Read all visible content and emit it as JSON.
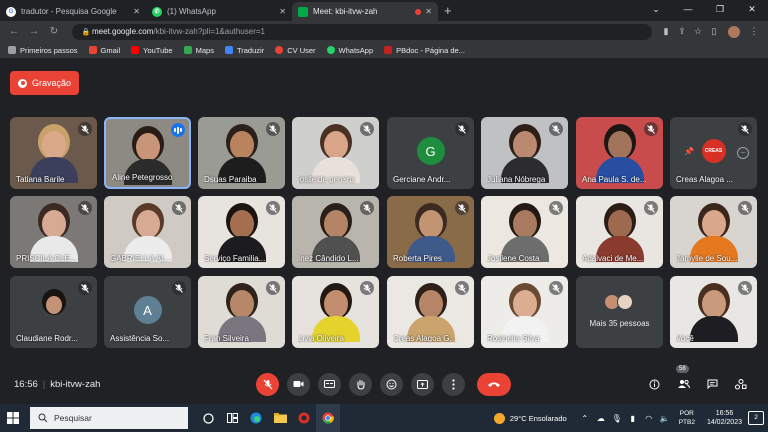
{
  "browser": {
    "tabs": [
      {
        "title": "tradutor - Pesquisa Google",
        "icon": "google-icon",
        "color": "#ffffff"
      },
      {
        "title": "(1) WhatsApp",
        "icon": "whatsapp-icon",
        "color": "#25d366"
      },
      {
        "title": "Meet: kbi-itvw-zah",
        "icon": "meet-icon",
        "color": "#00ac47",
        "active": true
      }
    ],
    "new_tab": "+",
    "url_host": "meet.google.com",
    "url_path": "/kbi-itvw-zah?pli=1&authuser=1",
    "bookmarks": [
      {
        "label": "Primeiros passos",
        "color": "#9aa0a6"
      },
      {
        "label": "Gmail",
        "color": "#ea4335"
      },
      {
        "label": "YouTube",
        "color": "#ff0000"
      },
      {
        "label": "Maps",
        "color": "#34a853"
      },
      {
        "label": "Traduzir",
        "color": "#4285f4"
      },
      {
        "label": "CV User",
        "color": "#ea4335"
      },
      {
        "label": "WhatsApp",
        "color": "#25d366"
      },
      {
        "label": "PBdoc - Página de...",
        "color": "#c5221f"
      }
    ]
  },
  "meet": {
    "recording_label": "Gravação",
    "participants": [
      {
        "name": "Tatiana Barile",
        "skin": "#d9a98a",
        "hair": "#c9a26a",
        "bg": "#6b5a4b",
        "shirt": "#3b3f5c"
      },
      {
        "name": "Aline Petegrosso",
        "skin": "#c89578",
        "hair": "#2a1d17",
        "bg": "#8d8a84",
        "shirt": "#2b2b2b",
        "speaking": true
      },
      {
        "name": "Dsuas Paraiba",
        "skin": "#b9835f",
        "hair": "#2b211b",
        "bg": "#9b9b95",
        "shirt": "#1d1d1d"
      },
      {
        "name": "josileide pereira",
        "skin": "#d8a48a",
        "hair": "#4a3022",
        "bg": "#cfcfcd",
        "shirt": "#e8e1db"
      },
      {
        "name": "Gerciane Andr...",
        "avatar_letter": "G",
        "avatar_color": "#1e8e3e"
      },
      {
        "name": "Juliana Nóbrega",
        "skin": "#b98a70",
        "hair": "#2d2019",
        "bg": "#bfc1c3",
        "shirt": "#2b2b30"
      },
      {
        "name": "Ana Paula S. de...",
        "skin": "#a0735a",
        "hair": "#1d1714",
        "bg": "#c94c4c",
        "shirt": "#274ea0"
      },
      {
        "name": "Creas Alagoa ...",
        "logo_text": "CREAS",
        "pinnable": true
      },
      {
        "name": "PRISCILA CLE...",
        "skin": "#d7ab93",
        "hair": "#3b2a22",
        "bg": "#7c7875",
        "shirt": "#e9e9ea"
      },
      {
        "name": "GABRIELLA AL...",
        "skin": "#d7ab93",
        "hair": "#5a3a29",
        "bg": "#cfcac4",
        "shirt": "#ececec"
      },
      {
        "name": "Serviço Familia...",
        "skin": "#a46f50",
        "hair": "#1b1411",
        "bg": "#e7e3de",
        "shirt": "#1c1c1e"
      },
      {
        "name": "Inez Cândido L...",
        "skin": "#b38465",
        "hair": "#2a1e18",
        "bg": "#b8b5ad",
        "shirt": "#505050"
      },
      {
        "name": "Roberta Pires",
        "skin": "#c29472",
        "hair": "#3a2a20",
        "bg": "#8a6b48",
        "shirt": "#3e5a8b"
      },
      {
        "name": "Josilene Costa",
        "skin": "#a87b60",
        "hair": "#241913",
        "bg": "#ece8e1",
        "shirt": "#6d6d6d"
      },
      {
        "name": "Adalvaci de Me...",
        "skin": "#9d6a4f",
        "hair": "#2b1d16",
        "bg": "#e9e6e1",
        "shirt": "#8b3a2e"
      },
      {
        "name": "Jamylle de Sou...",
        "skin": "#d9a78a",
        "hair": "#3b261b",
        "bg": "#d8d4cf",
        "shirt": "#e5791f"
      },
      {
        "name": "Claudiane Rodr...",
        "skin": "#c49377",
        "hair": "#1a1411",
        "bg": "#3c4043",
        "shirt": "#3c4043",
        "small": true
      },
      {
        "name": "Assistência So...",
        "avatar_letter": "A",
        "avatar_color": "#5f7f95"
      },
      {
        "name": "Fran Silveira",
        "skin": "#b7876a",
        "hair": "#2e221b",
        "bg": "#dfdcd6",
        "shirt": "#7a7680"
      },
      {
        "name": "Livia Oliveira",
        "skin": "#c28e6f",
        "hair": "#231913",
        "bg": "#e6e3de",
        "shirt": "#e4d32d"
      },
      {
        "name": "Creas Alagoa G...",
        "skin": "#b68466",
        "hair": "#2c2019",
        "bg": "#ebe8e3",
        "shirt": "#caa36d"
      },
      {
        "name": "Rosinelia Silva",
        "skin": "#dbae92",
        "hair": "#6b4a34",
        "bg": "#eeece9",
        "shirt": "#f2f2f2"
      },
      {
        "name": "Mais 35 pessoas",
        "more": true
      },
      {
        "name": "Você",
        "skin": "#c99a7c",
        "hair": "#4a2f21",
        "bg": "#e9e7e3",
        "shirt": "#1e1e22"
      }
    ],
    "time": "16:56",
    "meeting_code": "kbi-itvw-zah",
    "people_count": "58"
  },
  "taskbar": {
    "search_placeholder": "Pesquisar",
    "weather": "29°C  Ensolarado",
    "lang_top": "POR",
    "lang_bottom": "PTB2",
    "time": "16:56",
    "date": "14/02/2023",
    "notifications": "2"
  }
}
